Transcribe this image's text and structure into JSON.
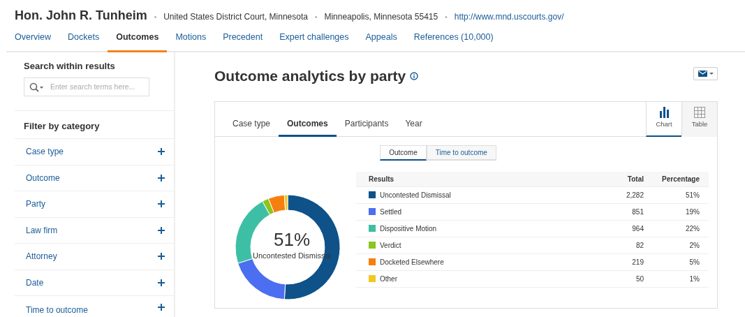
{
  "header": {
    "title": "Hon. John R. Tunheim",
    "meta": [
      {
        "separator": "•",
        "text": "United States District Court, Minnesota",
        "kind": "plain"
      },
      {
        "separator": "•",
        "text": "Minneapolis, Minnesota 55415",
        "kind": "plain"
      },
      {
        "separator": "•",
        "text": "http://www.mnd.uscourts.gov/",
        "kind": "link"
      }
    ]
  },
  "nav_tabs": [
    {
      "label": "Overview",
      "selected": false
    },
    {
      "label": "Dockets",
      "selected": false
    },
    {
      "label": "Outcomes",
      "selected": true
    },
    {
      "label": "Motions",
      "selected": false
    },
    {
      "label": "Precedent",
      "selected": false
    },
    {
      "label": "Expert challenges",
      "selected": false
    },
    {
      "label": "Appeals",
      "selected": false
    },
    {
      "label": "References (10,000)",
      "selected": false
    }
  ],
  "sidebar": {
    "search_title": "Search within results",
    "search_placeholder": "Enter search terms here...",
    "filter_title": "Filter by category",
    "filters": [
      {
        "label": "Case type",
        "expanded": false
      },
      {
        "label": "Outcome",
        "expanded": false
      },
      {
        "label": "Party",
        "expanded": false
      },
      {
        "label": "Law firm",
        "expanded": false
      },
      {
        "label": "Attorney",
        "expanded": false
      },
      {
        "label": "Date",
        "expanded": false
      },
      {
        "label": "Time to outcome",
        "expanded": false
      }
    ]
  },
  "main": {
    "title": "Outcome analytics by party",
    "view_tabs": [
      {
        "label": "Case type",
        "selected": false
      },
      {
        "label": "Outcomes",
        "selected": true
      },
      {
        "label": "Participants",
        "selected": false
      },
      {
        "label": "Year",
        "selected": false
      }
    ],
    "view_modes": [
      {
        "label": "Chart",
        "kind": "chart",
        "selected": true
      },
      {
        "label": "Table",
        "kind": "table",
        "selected": false
      }
    ],
    "sub_toggle": [
      {
        "label": "Outcome",
        "selected": true
      },
      {
        "label": "Time to outcome",
        "selected": false
      }
    ],
    "donut": {
      "value_label": "51%",
      "caption": "Uncontested Dismissal",
      "chart_data": {
        "type": "donut",
        "categories": [
          "Uncontested Dismissal",
          "Settled",
          "Dispositive Motion",
          "Verdict",
          "Docketed Elsewhere",
          "Other"
        ],
        "values": [
          51,
          19,
          22,
          2,
          5,
          1
        ]
      }
    },
    "table": {
      "columns": [
        "Results",
        "Total",
        "Percentage"
      ],
      "rows": [
        {
          "total": "2,282",
          "percentage": "51%",
          "color": "#0e5289"
        },
        {
          "total": "851",
          "percentage": "19%",
          "color": "#4c6ef0"
        },
        {
          "total": "964",
          "percentage": "22%",
          "color": "#3dbfa6"
        },
        {
          "total": "82",
          "percentage": "2%",
          "color": "#8cc51d"
        },
        {
          "total": "219",
          "percentage": "5%",
          "color": "#f77f0f"
        },
        {
          "total": "50",
          "percentage": "1%",
          "color": "#f2c81e"
        }
      ]
    }
  }
}
